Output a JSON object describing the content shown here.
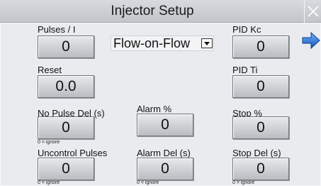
{
  "header": {
    "title": "Injector Setup"
  },
  "icons": {
    "close": "close-icon",
    "next": "arrow-right-icon"
  },
  "colors": {
    "arrow": "#1e6fd0",
    "background": "#e9ebee"
  },
  "mode_select": {
    "value": "Flow-on-Flow"
  },
  "fields": {
    "pulses_per_i": {
      "label": "Pulses / I",
      "value": "0"
    },
    "reset": {
      "label": "Reset",
      "value": "0.0"
    },
    "no_pulse_del": {
      "label": "No Pulse Del (s)",
      "value": "0",
      "note": "0 = ignore"
    },
    "uncontrol_pulses": {
      "label": "Uncontrol Pulses",
      "value": "0",
      "note": "0 = ignore"
    },
    "alarm_pct": {
      "label": "Alarm %",
      "value": "0"
    },
    "alarm_del": {
      "label": "Alarm Del (s)",
      "value": "0",
      "note": "0 = ignore"
    },
    "pid_kc": {
      "label": "PID Kc",
      "value": "0"
    },
    "pid_ti": {
      "label": "PID Ti",
      "value": "0"
    },
    "stop_pct": {
      "label": "Stop %",
      "value": "0"
    },
    "stop_del": {
      "label": "Stop Del (s)",
      "value": "0",
      "note": "0 = ignore"
    }
  }
}
